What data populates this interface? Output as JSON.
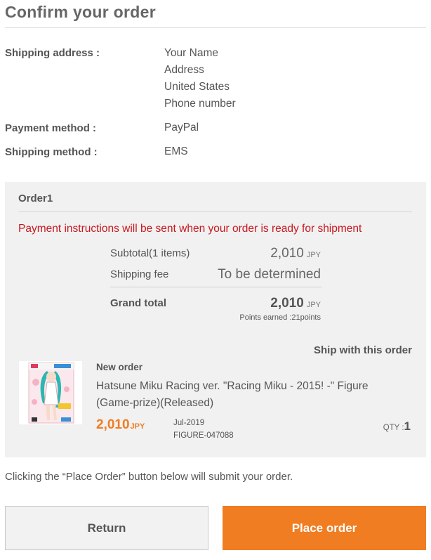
{
  "page": {
    "title": "Confirm your order"
  },
  "shipping": {
    "address_label": "Shipping address :",
    "address_lines": [
      "Your Name",
      "Address",
      "United States",
      "Phone number"
    ],
    "payment_label": "Payment method :",
    "payment_value": "PayPal",
    "method_label": "Shipping method :",
    "method_value": "EMS"
  },
  "order": {
    "title": "Order1",
    "notice": "Payment instructions will be sent when your order is ready for shipment",
    "subtotal_label": "Subtotal(1 items)",
    "subtotal_value": "2,010",
    "currency": "JPY",
    "shipping_fee_label": "Shipping fee",
    "shipping_fee_value": "To be determined",
    "grand_total_label": "Grand total",
    "grand_total_value": "2,010",
    "points": "Points earned :21points",
    "ship_with": "Ship with this order",
    "item": {
      "status": "New order",
      "name": "Hatsune Miku Racing ver. \"Racing Miku - 2015! -\" Figure (Game-prize)(Released)",
      "price": "2,010",
      "release": "Jul-2019",
      "code": "FIGURE-047088",
      "qty_label": "QTY :",
      "qty": "1"
    }
  },
  "footer": {
    "note": "Clicking the “Place Order” button below will submit your order.",
    "return_label": "Return",
    "place_label": "Place order"
  },
  "colors": {
    "accent": "#f07d22",
    "notice_red": "#c8171e",
    "panel_bg": "#f1f1f1"
  }
}
